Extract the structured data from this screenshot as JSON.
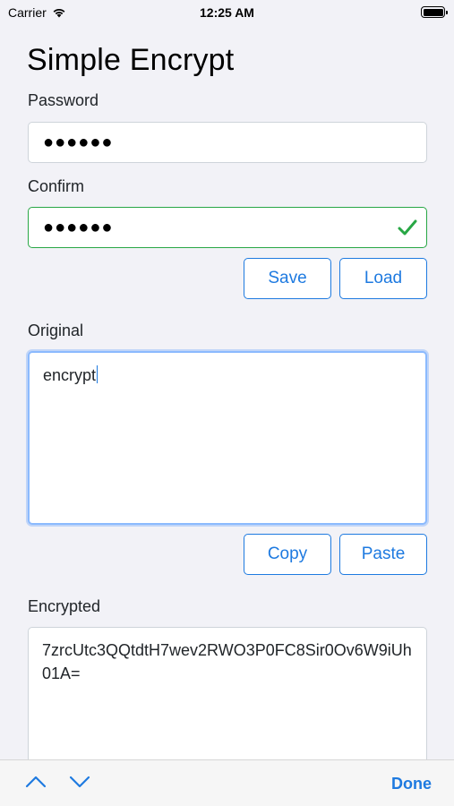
{
  "status_bar": {
    "carrier": "Carrier",
    "time": "12:25 AM",
    "battery_level": 1.0
  },
  "app": {
    "title": "Simple Encrypt"
  },
  "password": {
    "label": "Password",
    "value": "●●●●●●"
  },
  "confirm": {
    "label": "Confirm",
    "value": "●●●●●●",
    "valid": true
  },
  "key_actions": {
    "save_label": "Save",
    "load_label": "Load"
  },
  "original": {
    "label": "Original",
    "value": "encrypt"
  },
  "clipboard_actions": {
    "copy_label": "Copy",
    "paste_label": "Paste"
  },
  "encrypted": {
    "label": "Encrypted",
    "value": "7zrcUtc3QQtdtH7wev2RWO3P0FC8Sir0Ov6W9iUh01A="
  },
  "keyboard_accessory": {
    "prev_icon": "chevron-up-icon",
    "next_icon": "chevron-down-icon",
    "done_label": "Done"
  },
  "colors": {
    "accent": "#1e7ae0",
    "valid": "#28a745",
    "focus": "#8bbafe",
    "background": "#f2f2f7"
  }
}
